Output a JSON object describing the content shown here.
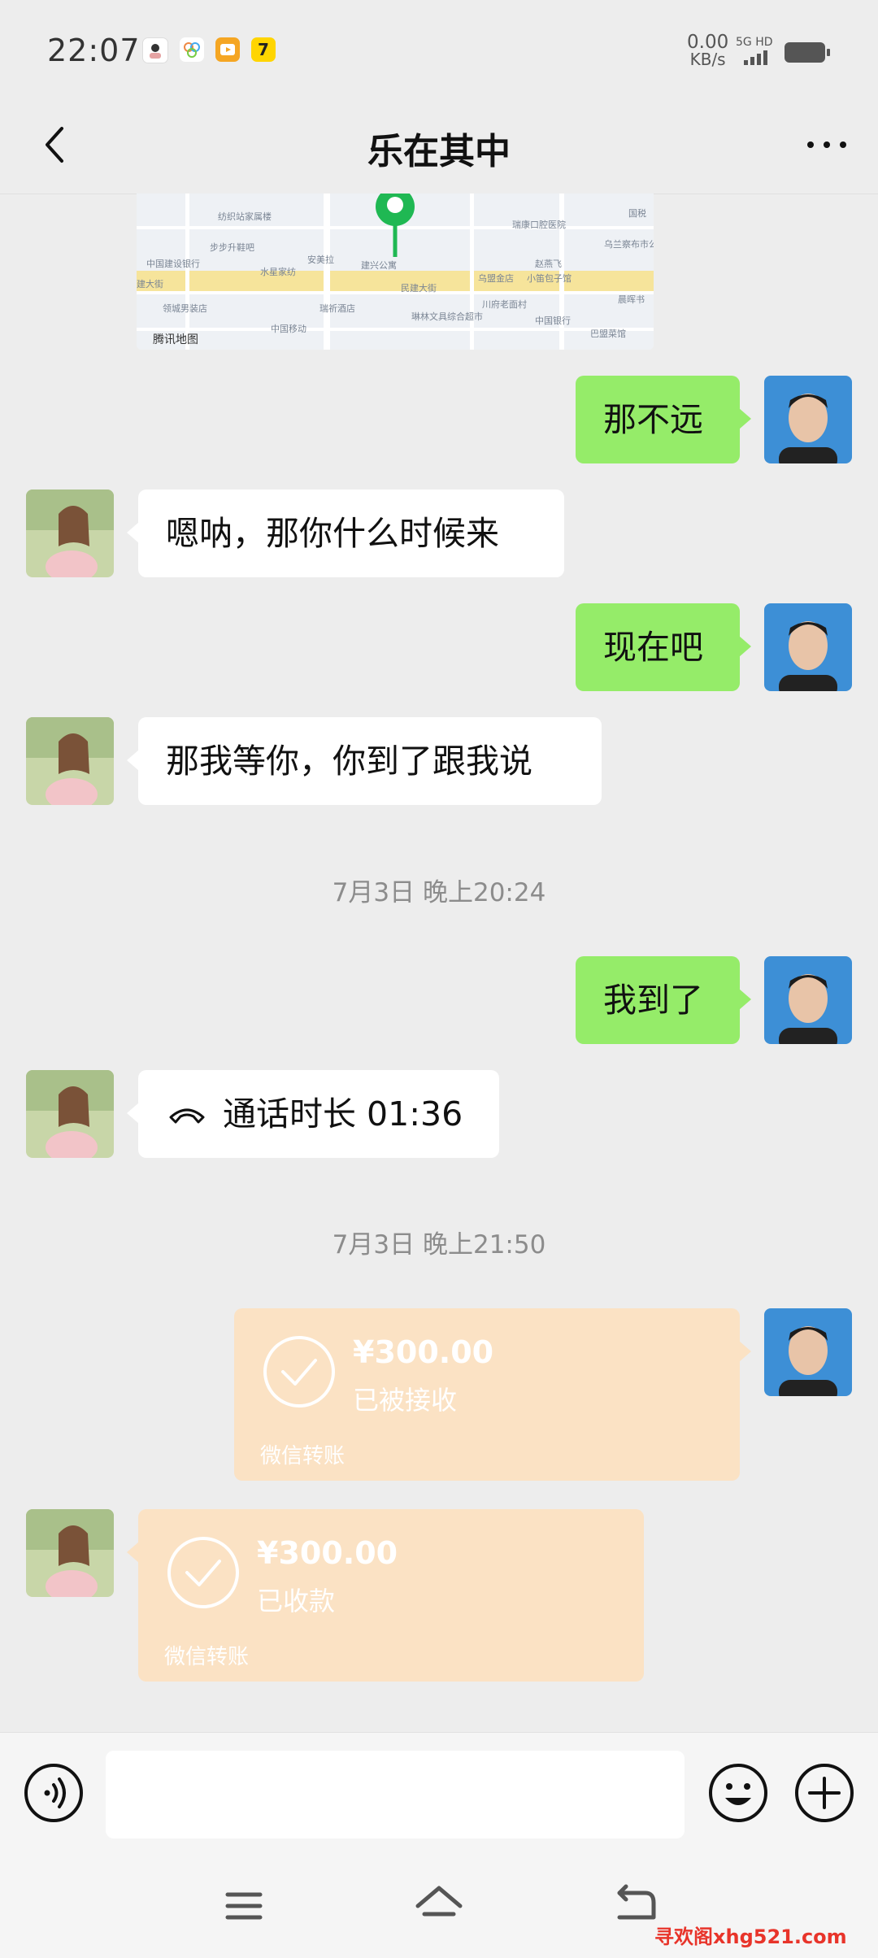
{
  "status_bar": {
    "time": "22:07",
    "net_speed_value": "0.00",
    "net_speed_unit": "KB/s",
    "network_label": "5G HD",
    "notification_icons": [
      "avatar-app-icon",
      "photos-app-icon",
      "video-app-icon",
      "seven-app-icon"
    ]
  },
  "header": {
    "title": "乐在其中",
    "back_icon": "chevron-left-icon",
    "more_icon": "more-dots-icon"
  },
  "map_preview": {
    "attribution": "腾讯地图",
    "labels": [
      "纺织站家属楼",
      "国税",
      "瑞康口腔医院",
      "步步升鞋吧",
      "建兴公寓",
      "乌兰察布市公证处",
      "中国建设银行",
      "水星家纺",
      "安美拉",
      "赵燕飞",
      "乌盟金店",
      "小笛包子馆",
      "民建大街",
      "建大街",
      "晨晖书",
      "领城男装店",
      "瑞祈酒店",
      "川府老面村",
      "琳林文具综合超市",
      "中国移动",
      "中国银行",
      "巴盟菜馆"
    ]
  },
  "messages": [
    {
      "side": "out",
      "text": "那不远"
    },
    {
      "side": "in",
      "text": "嗯呐，那你什么时候来"
    },
    {
      "side": "out",
      "text": "现在吧"
    },
    {
      "side": "in",
      "text": "那我等你，你到了跟我说"
    },
    {
      "type": "time",
      "text": "7月3日 晚上20:24"
    },
    {
      "side": "out",
      "text": "我到了"
    },
    {
      "side": "in",
      "type": "call",
      "text": "通话时长 01:36"
    },
    {
      "type": "time",
      "text": "7月3日 晚上21:50"
    },
    {
      "side": "out",
      "type": "transfer",
      "amount": "¥300.00",
      "status": "已被接收",
      "footer": "微信转账"
    },
    {
      "side": "in",
      "type": "transfer",
      "amount": "¥300.00",
      "status": "已收款",
      "footer": "微信转账"
    }
  ],
  "input_bar": {
    "voice_icon": "voice-icon",
    "emoji_icon": "emoji-icon",
    "plus_icon": "plus-icon",
    "input_value": ""
  },
  "nav_bar": {
    "icons": [
      "menu-icon",
      "home-icon",
      "back-icon"
    ]
  },
  "watermark": "寻欢阁xhg521.com",
  "colors": {
    "background": "#ededed",
    "outgoing_bubble": "#95ec69",
    "incoming_bubble": "#ffffff",
    "transfer_bubble": "#fbe2c4",
    "map_pin": "#1fb853",
    "watermark": "#e8342a"
  }
}
